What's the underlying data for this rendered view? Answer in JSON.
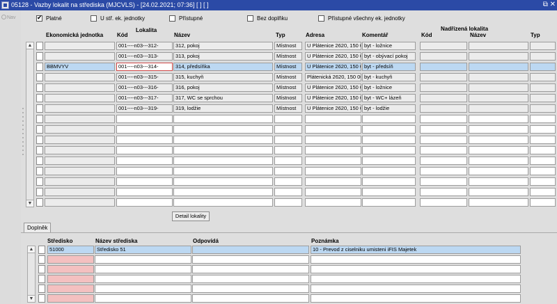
{
  "window": {
    "title": "05128 - Vazby lokalit na střediska (MJCVLS) - [24.02.2021; 07:36]  [ ]  [ ]",
    "controls": "⧉ ✕"
  },
  "sidebar": {
    "nav_label": "Nav"
  },
  "filters": [
    {
      "label": "Platné",
      "checked": true
    },
    {
      "label": "U stř. ek. jednotky",
      "checked": false
    },
    {
      "label": "Přístupné",
      "checked": false
    },
    {
      "label": "Bez doplňku",
      "checked": false
    },
    {
      "label": "Přístupné všechny ek. jednotky",
      "checked": false
    }
  ],
  "main_table": {
    "group_lokalita": "Lokalita",
    "group_nadrizena": "Nadřízená lokalita",
    "headers": {
      "ek_jednotka": "Ekonomická jednotka",
      "kod": "Kód",
      "nazev": "Název",
      "typ": "Typ",
      "adresa": "Adresa",
      "komentar": "Komentář",
      "n_kod": "Kód",
      "n_nazev": "Název",
      "n_typ": "Typ"
    },
    "rows": [
      {
        "ek": "",
        "kod": "001----n03---312-",
        "nazev": "312, pokoj",
        "typ": "Místnost",
        "adresa": "U Plátenice 2620, 150 0",
        "komentar": "byt - ložnice"
      },
      {
        "ek": "",
        "kod": "001----n03---313-",
        "nazev": "313, pokoj",
        "typ": "Místnost",
        "adresa": "U Plátenice 2620, 150 0",
        "komentar": "byt - obývací pokoj"
      },
      {
        "ek": "BBMVYV",
        "kod": "001----n03---314-",
        "nazev": "314, předsíňka",
        "typ": "Místnost",
        "adresa": "U Plátenice 2620, 150 0",
        "komentar": "byt - předsíň"
      },
      {
        "ek": "",
        "kod": "001----n03---315-",
        "nazev": "315, kuchyň",
        "typ": "Místnost",
        "adresa": "Plátenická 2620, 150 00",
        "komentar": "byt - kuchyň"
      },
      {
        "ek": "",
        "kod": "001----n03---316-",
        "nazev": "316, pokoj",
        "typ": "Místnost",
        "adresa": "U Plátenice 2620, 150 0",
        "komentar": "byt - ložnice"
      },
      {
        "ek": "",
        "kod": "001----n03---317-",
        "nazev": "317, WC se sprchou",
        "typ": "Místnost",
        "adresa": "U Plátenice 2620, 150 0",
        "komentar": "byt - WC+ lázeň"
      },
      {
        "ek": "",
        "kod": "001----n03---319-",
        "nazev": "319, lodžie",
        "typ": "Místnost",
        "adresa": "U Plátenice 2620, 150 0",
        "komentar": "byt - lodžie"
      }
    ],
    "detail_button": "Detail lokality"
  },
  "tabs": [
    {
      "label": "Doplněk"
    }
  ],
  "sub_table": {
    "headers": {
      "stredisko": "Středisko",
      "nazev": "Název střediska",
      "odpovida": "Odpovídá",
      "poznamka": "Poznámka"
    },
    "rows": [
      {
        "stredisko": "51000",
        "nazev": "Středisko 51",
        "odpovida": "",
        "poznamka": "10 - Prevod z ciselniku umisteni iFIS Majetek"
      }
    ]
  }
}
